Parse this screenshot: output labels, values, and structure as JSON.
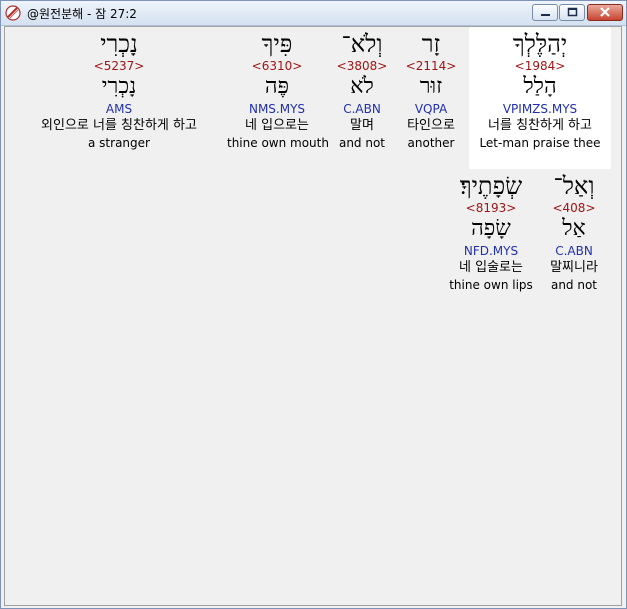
{
  "window": {
    "title": "@원전분해 - 잠 27:2"
  },
  "rows": [
    {
      "words": [
        {
          "hebrew": "נָכְרִי",
          "strong": "<5237>",
          "lemma": "נָכְרִי",
          "morph": "AMS",
          "korean": "외인으로 너를 칭찬하게 하고",
          "english": "a stranger",
          "highlighted": false
        },
        {
          "hebrew": "פִּיךָ",
          "strong": "<6310>",
          "lemma": "פֶּה",
          "morph": "NMS.MYS",
          "korean": "네 입으로는",
          "english": "thine own mouth",
          "highlighted": false
        },
        {
          "hebrew": "וְלֹא־",
          "strong": "<3808>",
          "lemma": "לֹא",
          "morph": "C.ABN",
          "korean": "말며",
          "english": "and not",
          "highlighted": false
        },
        {
          "hebrew": "זָר",
          "strong": "<2114>",
          "lemma": "זוּר",
          "morph": "VQPA",
          "korean": "타인으로",
          "english": "another",
          "highlighted": false
        },
        {
          "hebrew": "יְהַלֶּלְךָ",
          "strong": "<1984>",
          "lemma": "הָלַל",
          "morph": "VPIMZS.MYS",
          "korean": "너를 칭찬하게 하고",
          "english": "Let-man praise thee",
          "highlighted": true
        }
      ]
    },
    {
      "words": [
        {
          "hebrew": "שְׂפָתֶיךָ׃",
          "strong": "<8193>",
          "lemma": "שָׂפָה",
          "morph": "NFD.MYS",
          "korean": "네 입술로는",
          "english": "thine own lips",
          "highlighted": false
        },
        {
          "hebrew": "וְאַל־",
          "strong": "<408>",
          "lemma": "אַל",
          "morph": "C.ABN",
          "korean": "말찌니라",
          "english": "and not",
          "highlighted": false
        }
      ]
    }
  ]
}
